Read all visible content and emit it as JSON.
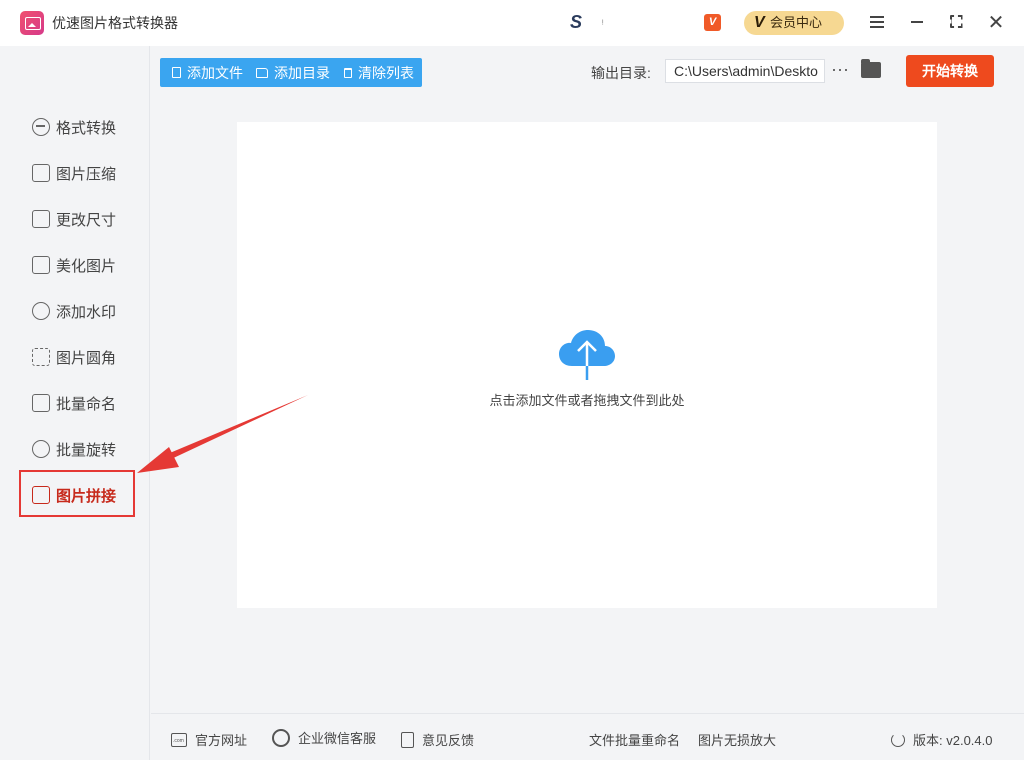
{
  "app": {
    "title": "优速图片格式转换器"
  },
  "header": {
    "vip_label": "会员中心",
    "vip_letter": "V",
    "vip_badge": "V",
    "s_logo": "S"
  },
  "sidebar": {
    "items": [
      {
        "label": "格式转换",
        "icon": "convert-icon"
      },
      {
        "label": "图片压缩",
        "icon": "compress-icon"
      },
      {
        "label": "更改尺寸",
        "icon": "resize-icon"
      },
      {
        "label": "美化图片",
        "icon": "beautify-icon"
      },
      {
        "label": "添加水印",
        "icon": "watermark-icon"
      },
      {
        "label": "图片圆角",
        "icon": "rounded-corner-icon"
      },
      {
        "label": "批量命名",
        "icon": "rename-icon"
      },
      {
        "label": "批量旋转",
        "icon": "rotate-icon"
      },
      {
        "label": "图片拼接",
        "icon": "splice-icon",
        "active": true
      }
    ]
  },
  "toolbar": {
    "add_file": "添加文件",
    "add_dir": "添加目录",
    "clear_list": "清除列表",
    "output_label": "输出目录:",
    "output_path": "C:\\Users\\admin\\Deskto",
    "more": "···",
    "start": "开始转换"
  },
  "main": {
    "drop_hint": "点击添加文件或者拖拽文件到此处"
  },
  "footer": {
    "official_site": "官方网址",
    "wechat_service": "企业微信客服",
    "feedback": "意见反馈",
    "batch_rename": "文件批量重命名",
    "lossless_zoom": "图片无损放大",
    "version": "版本: v2.0.4.0"
  },
  "colors": {
    "accent_blue": "#3aa5f0",
    "start_orange": "#ee4a1e",
    "active_red": "#c72a1c",
    "annotation_red": "#e53935",
    "vip_gold": "#f6d892"
  }
}
